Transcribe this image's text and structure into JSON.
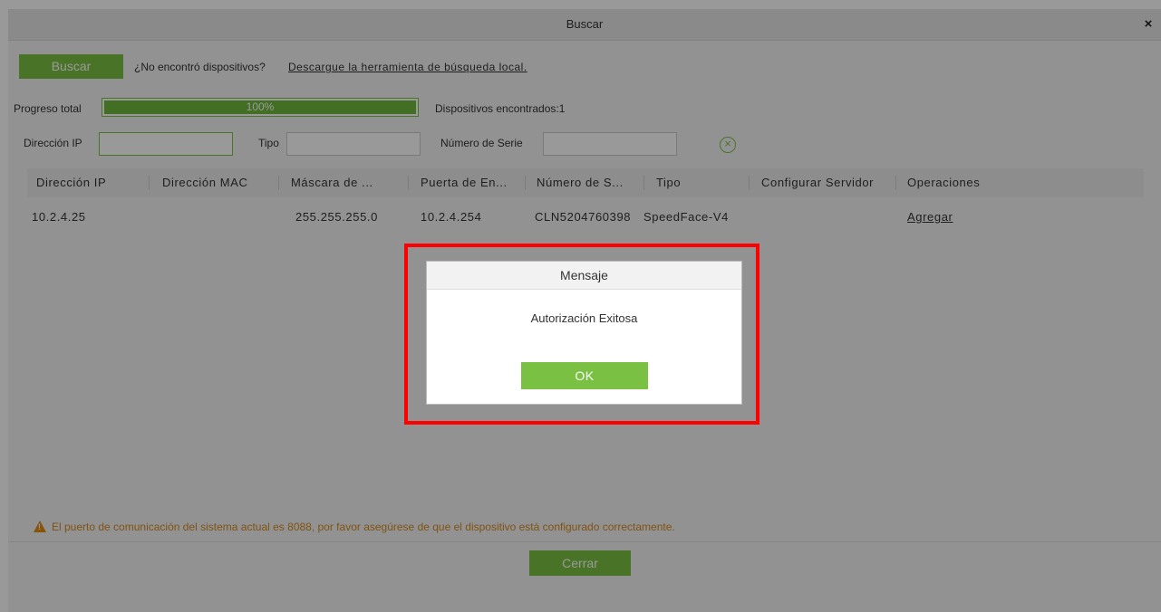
{
  "window": {
    "title": "Buscar",
    "close_symbol": "×"
  },
  "toolbar": {
    "search_button": "Buscar",
    "not_found_text": "¿No encontró dispositivos?",
    "download_link": "Descargue la herramienta de búsqueda local."
  },
  "progress": {
    "label": "Progreso total",
    "value_percent": 100,
    "text": "100%",
    "found_text": "Dispositivos encontrados:1"
  },
  "filters": {
    "ip_label": "Dirección IP",
    "ip_value": "",
    "type_label": "Tipo",
    "type_value": "",
    "serial_label": "Número de Serie",
    "serial_value": "",
    "clear_icon": "clear-circle-icon"
  },
  "table": {
    "columns": [
      "Dirección IP",
      "Dirección MAC",
      "Máscara de ...",
      "Puerta de En...",
      "Número de S...",
      "Tipo",
      "Configurar Servidor",
      "Operaciones"
    ],
    "rows": [
      {
        "ip": "10.2.4.25",
        "mac": "",
        "mask": "255.255.255.0",
        "gateway": "10.2.4.254",
        "serial": "CLN5204760398",
        "type": "SpeedFace-V4",
        "server": "",
        "action": "Agregar"
      }
    ]
  },
  "warning": {
    "icon": "warning-triangle-icon",
    "text": "El puerto de comunicación del sistema actual es 8088, por favor asegúrese de que el dispositivo está configurado correctamente."
  },
  "footer": {
    "close_button": "Cerrar"
  },
  "dialog": {
    "title": "Mensaje",
    "message": "Autorización Exitosa",
    "ok_button": "OK"
  },
  "colors": {
    "accent": "#7ac143",
    "highlight": "#ff0000",
    "warning": "#e08a10"
  }
}
